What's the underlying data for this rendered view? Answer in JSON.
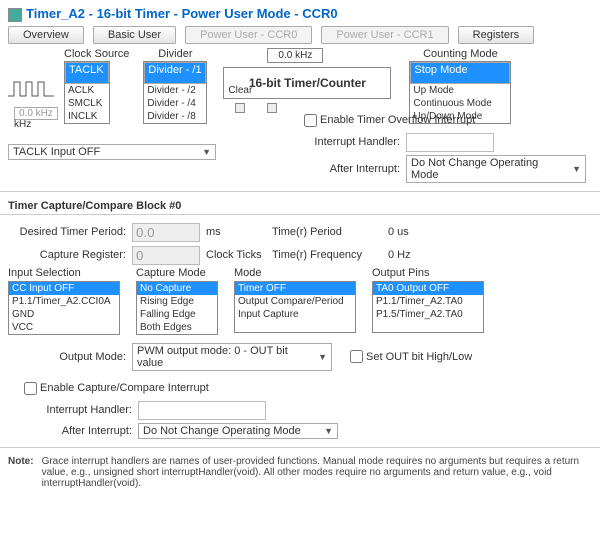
{
  "header": {
    "title": "Timer_A2 - 16-bit Timer - Power User Mode - CCR0"
  },
  "tabs": {
    "overview": "Overview",
    "basic": "Basic User",
    "pu0": "Power User - CCR0",
    "pu1": "Power User - CCR1",
    "regs": "Registers"
  },
  "labels": {
    "clockSource": "Clock Source",
    "divider": "Divider",
    "countMode": "Counting Mode",
    "timerBox": "16-bit Timer/Counter",
    "clear": "Clear",
    "khz": "kHz",
    "freq": "0.0 kHz",
    "topFreq": "0.0 kHz",
    "enableOvf": "Enable Timer Overflow Interrupt",
    "intHandler": "Interrupt Handler:",
    "afterInt": "After Interrupt:",
    "afterIntVal": "Do Not Change Operating Mode",
    "taclkOff": "TACLK Input OFF",
    "sectionTitle": "Timer Capture/Compare Block #0",
    "desiredPeriod": "Desired Timer Period:",
    "ms": "ms",
    "captureReg": "Capture Register:",
    "clockTicks": "Clock Ticks",
    "timerPeriod": "Time(r) Period",
    "periodVal": "0 us",
    "timerFreq": "Time(r) Frequency",
    "freqVal": "0 Hz",
    "inputSel": "Input Selection",
    "captureMode": "Capture Mode",
    "mode": "Mode",
    "outputPins": "Output Pins",
    "outputMode": "Output Mode:",
    "outputModeVal": "PWM output mode: 0 - OUT bit value",
    "setOut": "Set OUT bit High/Low",
    "enableCC": "Enable Capture/Compare Interrupt",
    "intHandler2": "Interrupt Handler:",
    "afterInt2": "After Interrupt:",
    "afterInt2Val": "Do Not Change Operating Mode",
    "noteLabel": "Note:",
    "noteText": "Grace interrupt handlers are names of user-provided functions. Manual mode requires no arguments but requires a return value, e.g., unsigned short interruptHandler(void). All other modes require no arguments and return value, e.g., void interruptHandler(void)."
  },
  "clockSrc": {
    "items": [
      "TACLK",
      "ACLK",
      "SMCLK",
      "INCLK"
    ],
    "sel": 0
  },
  "divider": {
    "items": [
      "Divider - /1",
      "Divider - /2",
      "Divider - /4",
      "Divider - /8"
    ],
    "sel": 0
  },
  "countMode": {
    "items": [
      "Stop Mode",
      "Up Mode",
      "Continuous Mode",
      "Up/Down Mode"
    ],
    "sel": 0
  },
  "periodInput": "0.0",
  "captureRegInput": "0",
  "inputSel": {
    "items": [
      "CC Input OFF",
      "P1.1/Timer_A2.CCI0A",
      "GND",
      "VCC"
    ],
    "sel": 0
  },
  "captureMode": {
    "items": [
      "No Capture",
      "Rising Edge",
      "Falling Edge",
      "Both Edges"
    ],
    "sel": 0
  },
  "modeList": {
    "items": [
      "Timer OFF",
      "Output Compare/Period",
      "Input Capture"
    ],
    "sel": 0
  },
  "outputPins": {
    "items": [
      "TA0 Output OFF",
      "P1.1/Timer_A2.TA0",
      "P1.5/Timer_A2.TA0"
    ],
    "sel": 0
  }
}
